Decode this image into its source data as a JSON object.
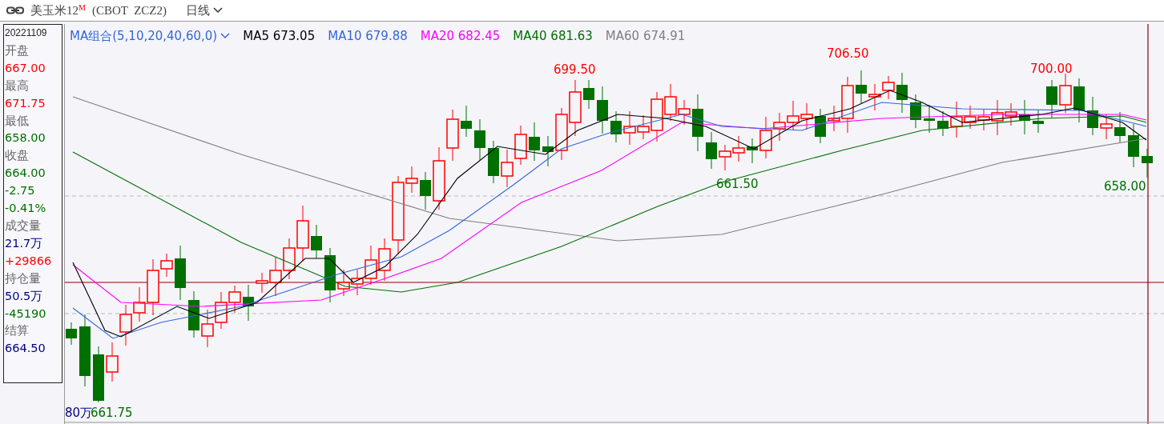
{
  "header": {
    "title": "美玉米12$^{M}$",
    "symbol": "(CBOT  ZCZ2)",
    "period": "日线"
  },
  "info_panel": {
    "date": "20221109",
    "rows": [
      {
        "label": "开盘",
        "values": [
          {
            "text": "667.00",
            "color": "#ff0000"
          }
        ]
      },
      {
        "label": "最高",
        "values": [
          {
            "text": "671.75",
            "color": "#ff0000"
          }
        ]
      },
      {
        "label": "最低",
        "values": [
          {
            "text": "658.00",
            "color": "#007000"
          }
        ]
      },
      {
        "label": "收盘",
        "values": [
          {
            "text": "664.00",
            "color": "#007000"
          },
          {
            "text": "-2.75",
            "color": "#007000"
          },
          {
            "text": "-0.41%",
            "color": "#007000"
          }
        ]
      },
      {
        "label": "成交量",
        "values": [
          {
            "text": "21.7万",
            "color": "#000080"
          },
          {
            "text": "+29866",
            "color": "#ff0000"
          }
        ]
      },
      {
        "label": "持仓量",
        "values": [
          {
            "text": "50.5万",
            "color": "#000080"
          },
          {
            "text": "-45190",
            "color": "#007000"
          }
        ]
      },
      {
        "label": "结算",
        "values": [
          {
            "text": "664.50",
            "color": "#000080"
          }
        ]
      }
    ]
  },
  "legend": {
    "selector": "MA组合(5,10,20,40,60,0)",
    "items": [
      {
        "text": "MA5 673.05",
        "color": "#000000"
      },
      {
        "text": "MA10 679.88",
        "color": "#3366dd"
      },
      {
        "text": "MA20 682.45",
        "color": "#ff00ff"
      },
      {
        "text": "MA40 681.63",
        "color": "#007000"
      },
      {
        "text": "MA60 674.91",
        "color": "#808080"
      }
    ]
  },
  "annotations": [
    {
      "text": "699.50",
      "color": "#ff0000"
    },
    {
      "text": "706.50",
      "color": "#ff0000"
    },
    {
      "text": "700.00",
      "color": "#ff0000"
    },
    {
      "text": "661.50",
      "color": "#007000"
    },
    {
      "text": "658.00",
      "color": "#007000"
    },
    {
      "text": "661.75",
      "color": "#007000"
    },
    {
      "text": "80万",
      "color": "#000080"
    }
  ]
}
